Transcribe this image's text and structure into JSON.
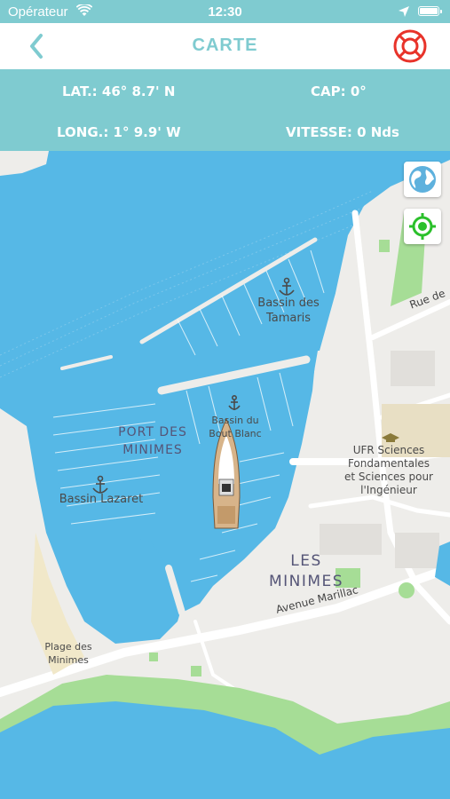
{
  "status_bar": {
    "carrier": "Opérateur",
    "time": "12:30"
  },
  "header": {
    "title": "CARTE",
    "back_icon": "chevron-left-icon",
    "help_icon": "lifebuoy-icon"
  },
  "info": {
    "latitude": "LAT.: 46° 8.7' N",
    "heading": "CAP: 0°",
    "longitude": "LONG.: 1° 9.9' W",
    "speed": "VITESSE: 0 Nds"
  },
  "map": {
    "buttons": {
      "globe_icon": "globe-icon",
      "locate_icon": "locate-icon"
    },
    "labels": {
      "bassin_tamaris_1": "Bassin des",
      "bassin_tamaris_2": "Tamaris",
      "bassin_bout_blanc_1": "Bassin du",
      "bassin_bout_blanc_2": "Bout Blanc",
      "port_1": "PORT DES",
      "port_2": "MINIMES",
      "bassin_lazaret": "Bassin Lazaret",
      "ufr_1": "UFR Sciences",
      "ufr_2": "Fondamentales",
      "ufr_3": "et Sciences pour",
      "ufr_4": "l'Ingénieur",
      "les_1": "LES",
      "les_2": "MINIMES",
      "avenue": "Avenue Marillac",
      "rue": "Rue de",
      "plage_1": "Plage des",
      "plage_2": "Minimes"
    },
    "colors": {
      "water": "#56b8e6",
      "land": "#eeedea",
      "park": "#a6dd96",
      "accent": "#7fcbd0",
      "alert": "#e8332a"
    }
  }
}
